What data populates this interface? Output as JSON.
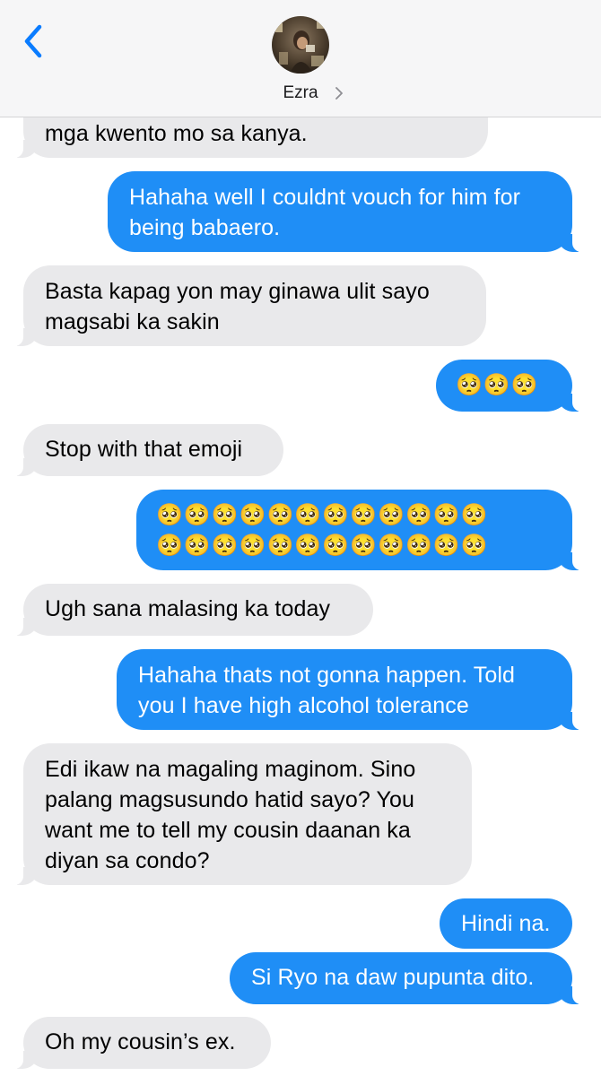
{
  "header": {
    "back_icon": "chevron-left-icon",
    "contact_name": "Ezra",
    "chevron_icon": "chevron-right-icon",
    "accent": "#0a7cff"
  },
  "messages": [
    {
      "side": "received",
      "text": "mga kwento mo sa kanya."
    },
    {
      "side": "sent",
      "lines": [
        "Hahaha well I couldnt vouch for him for",
        "being babaero."
      ]
    },
    {
      "side": "received",
      "lines": [
        "Basta kapag yon may ginawa ulit sayo",
        "magsabi ka sakin"
      ]
    },
    {
      "side": "sent",
      "emoji": "🥺🥺🥺"
    },
    {
      "side": "received",
      "text": "Stop with that emoji"
    },
    {
      "side": "sent",
      "emoji_lines": [
        "🥺🥺🥺🥺🥺🥺🥺🥺🥺🥺🥺🥺",
        "🥺🥺🥺🥺🥺🥺🥺🥺🥺🥺🥺🥺"
      ]
    },
    {
      "side": "received",
      "text": "Ugh sana malasing ka today"
    },
    {
      "side": "sent",
      "lines": [
        "Hahaha thats not gonna happen. Told",
        "you I have high alcohol tolerance"
      ]
    },
    {
      "side": "received",
      "lines": [
        "Edi ikaw na magaling maginom. Sino",
        "palang magsusundo hatid sayo? You",
        "want me to tell my cousin daanan ka",
        "diyan sa condo?"
      ]
    },
    {
      "side": "sent",
      "text": "Hindi na."
    },
    {
      "side": "sent",
      "text": "Si Ryo na daw pupunta dito."
    },
    {
      "side": "received",
      "text": "Oh my cousin’s ex."
    }
  ],
  "colors": {
    "sent_bubble": "#1f8ef6",
    "received_bubble": "#e9e9eb",
    "header_bg": "#f6f6f7"
  }
}
